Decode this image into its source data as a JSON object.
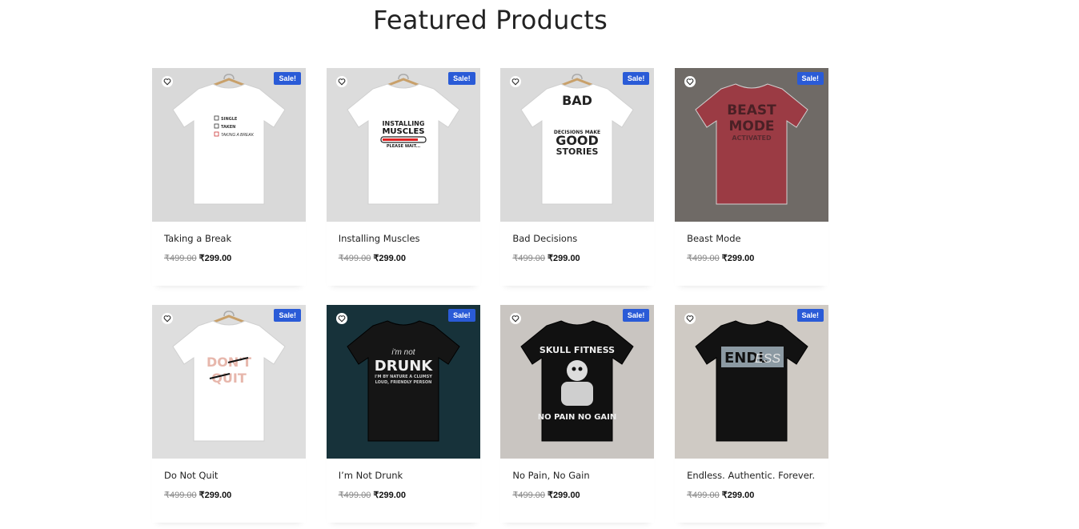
{
  "section": {
    "title": "Featured Products"
  },
  "products": [
    {
      "name": "Taking a Break",
      "old_price": "₹499.00",
      "price": "₹299.00",
      "badge": "Sale!",
      "bg": "#d9d9d9",
      "shirt": "#ffffff",
      "art": [
        "SINGLE",
        "TAKEN",
        "TAKING A BREAK"
      ]
    },
    {
      "name": "Installing Muscles",
      "old_price": "₹499.00",
      "price": "₹299.00",
      "badge": "Sale!",
      "bg": "#dcdcdc",
      "shirt": "#ffffff",
      "art": [
        "INSTALLING",
        "MUSCLES",
        "PLEASE WAIT..."
      ]
    },
    {
      "name": "Bad Decisions",
      "old_price": "₹499.00",
      "price": "₹299.00",
      "badge": "Sale!",
      "bg": "#dadada",
      "shirt": "#ffffff",
      "art": [
        "BAD",
        "DECISIONS MAKE",
        "GOOD",
        "STORIES"
      ]
    },
    {
      "name": "Beast Mode",
      "old_price": "₹499.00",
      "price": "₹299.00",
      "badge": "Sale!",
      "bg": "#6f6a66",
      "shirt": "#9b3b44",
      "art": [
        "BEAST",
        "MODE",
        "ACTIVATED"
      ]
    },
    {
      "name": "Do Not Quit",
      "old_price": "₹499.00",
      "price": "₹299.00",
      "badge": "Sale!",
      "bg": "#dedede",
      "shirt": "#ffffff",
      "art": [
        "DON'T",
        "QUIT"
      ]
    },
    {
      "name": "I’m Not Drunk",
      "old_price": "₹499.00",
      "price": "₹299.00",
      "badge": "Sale!",
      "bg": "#17323a",
      "shirt": "#151515",
      "art": [
        "i'm not",
        "DRUNK",
        "I'M BY NATURE A CLUMSY",
        "LOUD, FRIENDLY PERSON"
      ]
    },
    {
      "name": "No Pain, No Gain",
      "old_price": "₹499.00",
      "price": "₹299.00",
      "badge": "Sale!",
      "bg": "#c9c5c1",
      "shirt": "#111111",
      "art": [
        "SKULL FITNESS",
        "NO PAIN NO GAIN"
      ]
    },
    {
      "name": "Endless. Authentic. Forever.",
      "old_price": "₹499.00",
      "price": "₹299.00",
      "badge": "Sale!",
      "bg": "#cfcac4",
      "shirt": "#121212",
      "art": [
        "ENDL",
        "ESS"
      ]
    }
  ]
}
